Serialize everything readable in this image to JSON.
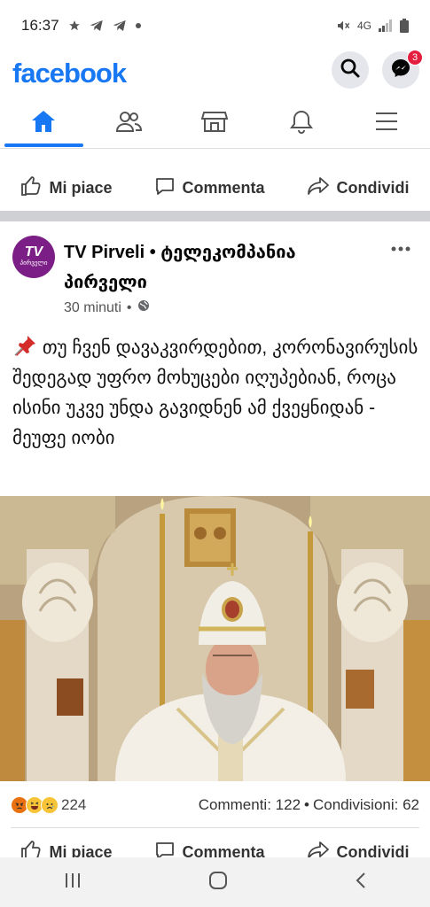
{
  "status_bar": {
    "time": "16:37",
    "network": "4G"
  },
  "header": {
    "logo": "facebook",
    "messenger_badge": "3"
  },
  "tabs": [
    {
      "name": "home",
      "active": true
    },
    {
      "name": "friends",
      "active": false
    },
    {
      "name": "marketplace",
      "active": false
    },
    {
      "name": "notifications",
      "active": false
    },
    {
      "name": "menu",
      "active": false
    }
  ],
  "actions": {
    "like": "Mi piace",
    "comment": "Commenta",
    "share": "Condividi"
  },
  "post": {
    "page_name": "TV Pirveli • ტელეკომპანია პირველი",
    "avatar_text": "TV",
    "avatar_sub": "პირველი",
    "time": "30 minuti",
    "text": "თუ ჩვენ დავაკვირდებით, კორონავირუსის შედეგად უფრო მოხუცები იღუპებიან, როცა ისინი უკვე უნდა გავიდნენ ამ ქვეყნიდან - მეუფე იობი",
    "reaction_count": "224",
    "comments": "Commenti: 122",
    "shares": "Condivisioni: 62",
    "stats_sep": "•"
  },
  "colors": {
    "brand": "#1877f2",
    "badge": "#e41e3f"
  }
}
